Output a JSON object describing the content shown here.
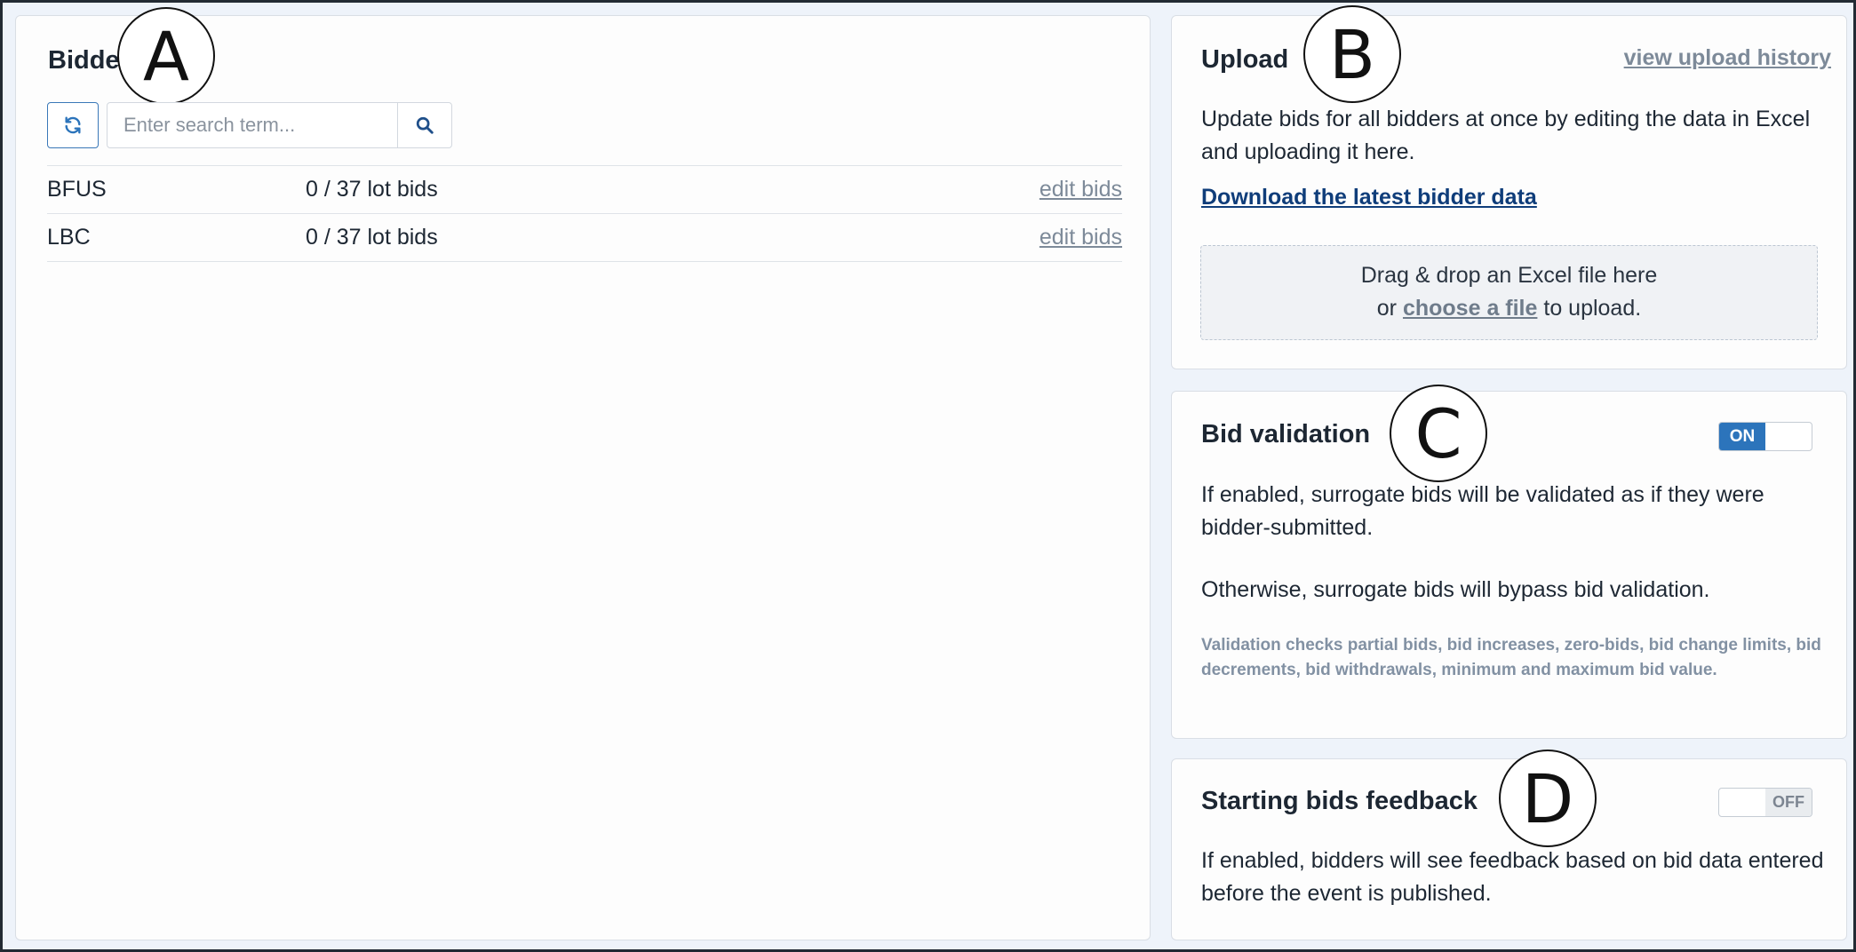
{
  "bidders_panel": {
    "title": "Bidders",
    "callout": "A",
    "refresh_icon": "refresh-icon",
    "search_placeholder": "Enter search term...",
    "search_icon": "search-icon",
    "rows": [
      {
        "name": "BFUS",
        "bids": "0 / 37 lot bids",
        "action": "edit bids"
      },
      {
        "name": "LBC",
        "bids": "0 / 37 lot bids",
        "action": "edit bids"
      }
    ]
  },
  "upload_panel": {
    "title": "Upload",
    "callout": "B",
    "history_link": "view upload history",
    "description": "Update bids for all bidders at once by editing the data in Excel and uploading it here.",
    "download_link": "Download the latest bidder data",
    "dropzone": {
      "line1": "Drag & drop an Excel file here",
      "prefix": "or",
      "link": "choose a file",
      "suffix": "to upload."
    }
  },
  "validation_panel": {
    "title": "Bid validation",
    "callout": "C",
    "toggle_label": "ON",
    "toggle_state": "on",
    "paragraph1": "If enabled, surrogate bids will be validated as if they were bidder-submitted.",
    "paragraph2": "Otherwise, surrogate bids will bypass bid validation.",
    "note": "Validation checks partial bids, bid increases, zero-bids, bid change limits, bid decrements, bid withdrawals, minimum and maximum bid value."
  },
  "feedback_panel": {
    "title": "Starting bids feedback",
    "callout": "D",
    "toggle_label": "OFF",
    "toggle_state": "off",
    "paragraph": "If enabled, bidders will see feedback based on bid data entered before the event is published."
  },
  "colors": {
    "accent": "#2c74bb",
    "link_dark": "#0f3d7a",
    "link_muted": "#7d8a99",
    "background": "#eef3fa"
  }
}
